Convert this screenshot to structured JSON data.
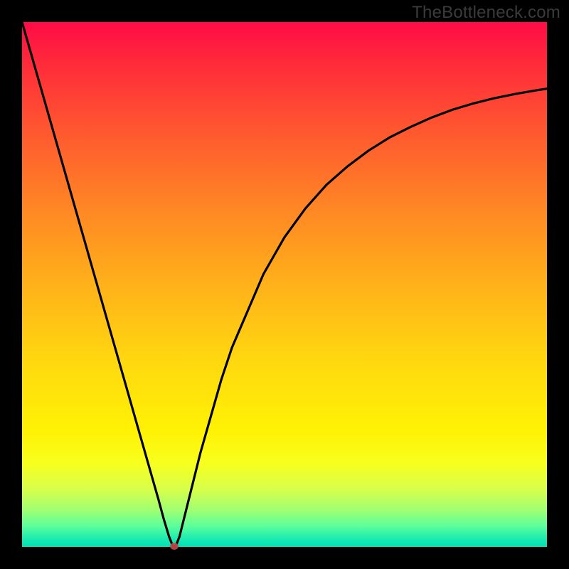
{
  "watermark": "TheBottleneck.com",
  "colors": {
    "frame": "#000000",
    "curve": "#000000",
    "marker": "#c24a47",
    "gradient_top": "#ff0b46",
    "gradient_bottom": "#00e0b8"
  },
  "chart_data": {
    "type": "line",
    "title": "",
    "xlabel": "",
    "ylabel": "",
    "xlim": [
      0,
      100
    ],
    "ylim": [
      0,
      100
    ],
    "x": [
      0,
      2,
      4,
      6,
      8,
      10,
      12,
      14,
      16,
      18,
      20,
      22,
      24,
      26,
      27,
      28,
      28.7,
      29.3,
      30,
      31,
      32,
      34,
      36,
      38,
      40,
      43,
      46,
      50,
      54,
      58,
      62,
      66,
      70,
      74,
      78,
      82,
      86,
      90,
      94,
      98,
      100
    ],
    "y": [
      100,
      93,
      86,
      79,
      72,
      65,
      58,
      51,
      44,
      37,
      30,
      23,
      16,
      9,
      5.3,
      2,
      0.2,
      0.2,
      2,
      6,
      10,
      18,
      25,
      32,
      38,
      45,
      52,
      59,
      64.5,
      69,
      72.5,
      75.5,
      78,
      80,
      81.8,
      83.3,
      84.5,
      85.5,
      86.3,
      87,
      87.3
    ],
    "marker": {
      "x": 29,
      "y": 0
    },
    "grid": false,
    "legend": false
  }
}
